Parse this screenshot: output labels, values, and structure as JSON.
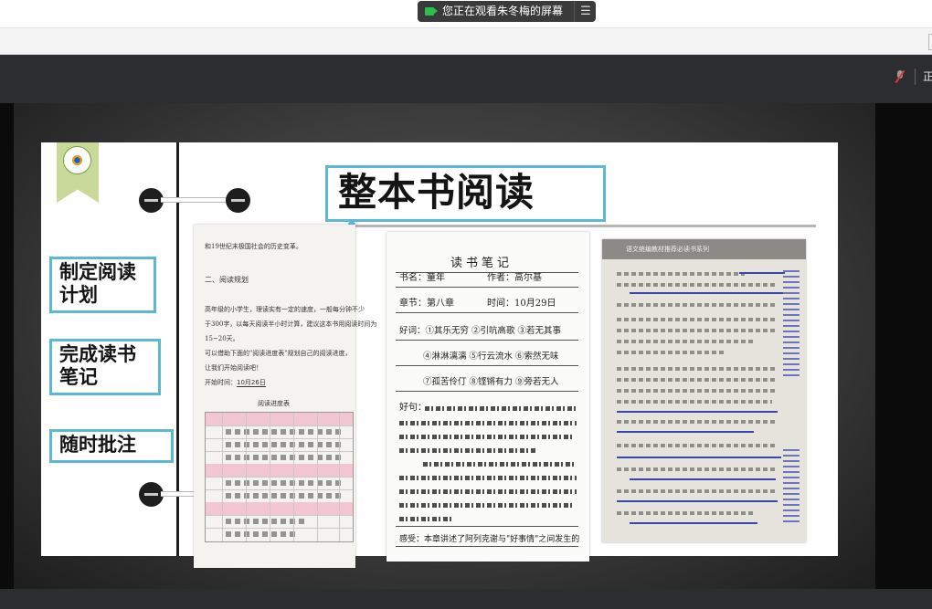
{
  "topbar": {
    "share_notice": "您正在观看朱冬梅的屏幕",
    "menu_icon": "list-menu-icon"
  },
  "meeting_toolbar": {
    "mic_icon": "mic-muted-icon",
    "status_text": "正"
  },
  "slide": {
    "title": "整本书阅读",
    "steps": [
      {
        "label": "制定阅读\n计划"
      },
      {
        "label": "完成读书\n笔记"
      },
      {
        "label": "随时批注"
      }
    ],
    "accent_color": "#5bb9d5",
    "plan_page": {
      "line1": "和19世纪末极国社会的历史变革。",
      "heading": "二、阅读规划",
      "para1": "高年级的小学生，理读实有一定的速度，一般每分钟不少",
      "para2": "于300字，以每天阅读半小时计算，建议这本书用阅读时间为",
      "para3": "15~20天。",
      "para4": "可以借助下面的\"阅读进度表\"规划自己的阅读进度，",
      "para5": "让我们开始阅读吧！",
      "start_time_label": "开始时间：",
      "start_time_value": "10月26日",
      "table_caption": "阅读进度表"
    },
    "note_page": {
      "title": "读书笔记",
      "book": "书名：童年",
      "author": "作者：高尔基",
      "chapter": "章节：第八章",
      "time": "时间：10月29日",
      "words_row1": "好词：①其乐无穷 ②引吭高歌 ③若无其事",
      "words_row2": "④淋淋漓漓 ⑤行云流水 ⑥索然无味",
      "words_row3": "⑦孤苦伶仃 ⑧铿锵有力 ⑨旁若无人",
      "sentences_label": "好句：",
      "feeling": "感受：本章讲述了阿列克谢与\"好事情\"之间发生的"
    },
    "book_page": {
      "header": "语文统编教材推荐必读书系列"
    }
  }
}
